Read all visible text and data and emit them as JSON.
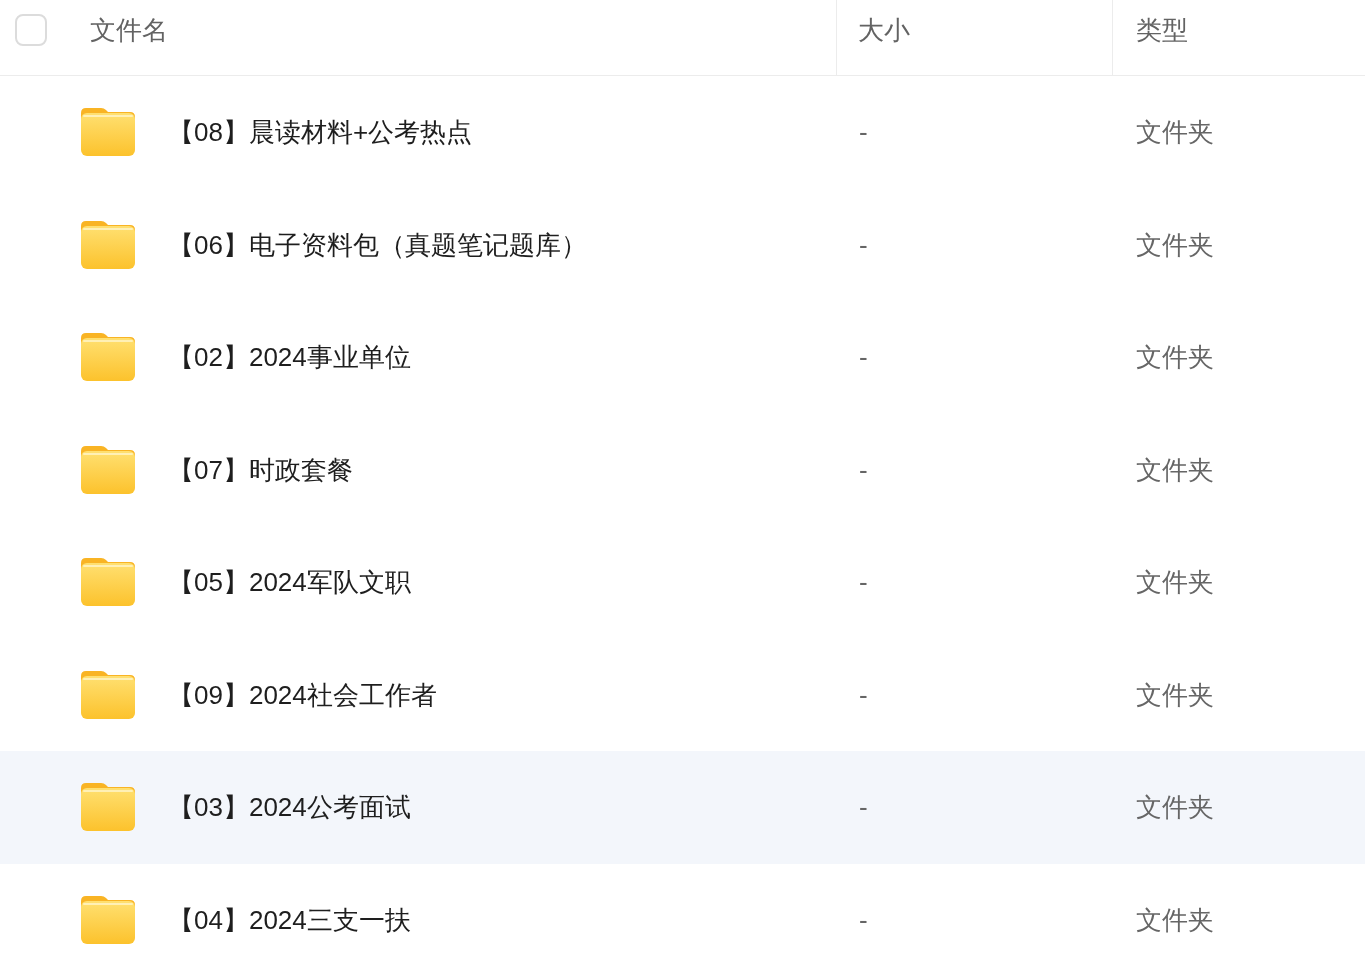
{
  "header": {
    "checkbox_checked": false,
    "columns": [
      {
        "label": "文件名"
      },
      {
        "label": "大小"
      },
      {
        "label": "类型"
      }
    ]
  },
  "rows": [
    {
      "name": "【08】晨读材料+公考热点",
      "size": "-",
      "type": "文件夹",
      "highlighted": false
    },
    {
      "name": "【06】电子资料包（真题笔记题库）",
      "size": "-",
      "type": "文件夹",
      "highlighted": false
    },
    {
      "name": "【02】2024事业单位",
      "size": "-",
      "type": "文件夹",
      "highlighted": false
    },
    {
      "name": "【07】时政套餐",
      "size": "-",
      "type": "文件夹",
      "highlighted": false
    },
    {
      "name": "【05】2024军队文职",
      "size": "-",
      "type": "文件夹",
      "highlighted": false
    },
    {
      "name": "【09】2024社会工作者",
      "size": "-",
      "type": "文件夹",
      "highlighted": false
    },
    {
      "name": "【03】2024公考面试",
      "size": "-",
      "type": "文件夹",
      "highlighted": true
    },
    {
      "name": "【04】2024三支一扶",
      "size": "-",
      "type": "文件夹",
      "highlighted": false
    }
  ]
}
